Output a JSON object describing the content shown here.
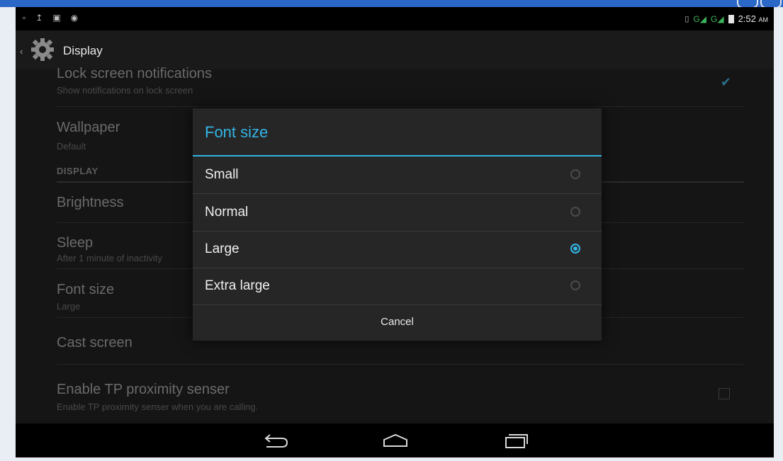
{
  "status_bar": {
    "left_icons": [
      "usb-icon",
      "upload-icon",
      "image-icon",
      "android-icon"
    ],
    "network_g1": "G",
    "network_g2": "G",
    "time": "2:52",
    "ampm": "AM"
  },
  "action_bar": {
    "title": "Display",
    "icon": "gear-icon"
  },
  "settings": {
    "lock_screen": {
      "title": "Lock screen notifications",
      "subtitle": "Show notifications on lock screen",
      "checked": true
    },
    "wallpaper": {
      "title": "Wallpaper",
      "subtitle": "Default"
    },
    "section_display": "DISPLAY",
    "brightness": {
      "title": "Brightness"
    },
    "sleep": {
      "title": "Sleep",
      "subtitle": "After 1 minute of inactivity"
    },
    "font_size": {
      "title": "Font size",
      "subtitle": "Large"
    },
    "cast_screen": {
      "title": "Cast screen"
    },
    "tp_proximity": {
      "title": "Enable TP proximity senser",
      "subtitle": "Enable TP proximity senser when you are calling.",
      "checked": false
    }
  },
  "dialog": {
    "title": "Font size",
    "options": [
      {
        "label": "Small",
        "selected": false
      },
      {
        "label": "Normal",
        "selected": false
      },
      {
        "label": "Large",
        "selected": true
      },
      {
        "label": "Extra large",
        "selected": false
      }
    ],
    "cancel_label": "Cancel"
  },
  "nav_bar": {
    "buttons": [
      "back-icon",
      "home-icon",
      "recent-apps-icon"
    ]
  },
  "colors": {
    "accent": "#33b5e5",
    "dialog_bg": "#262626",
    "action_bar_bg": "#1a1a1a",
    "window_frame": "#2a67c7"
  }
}
